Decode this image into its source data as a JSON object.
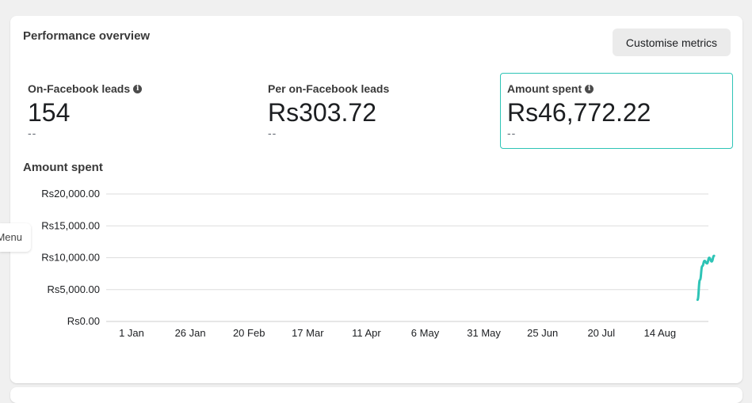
{
  "card": {
    "title": "Performance overview",
    "customise_label": "Customise metrics"
  },
  "metrics": [
    {
      "label": "On-Facebook leads",
      "has_info": true,
      "value": "154",
      "comparison": "--",
      "selected": false
    },
    {
      "label": "Per on-Facebook leads",
      "has_info": false,
      "value": "Rs303.72",
      "comparison": "--",
      "selected": false
    },
    {
      "label": "Amount spent",
      "has_info": true,
      "value": "Rs46,772.22",
      "comparison": "--",
      "selected": true
    }
  ],
  "side_menu": {
    "label": "Menu"
  },
  "icons": {
    "info": "info-icon"
  },
  "colors": {
    "accent": "#2ec4b6",
    "grid": "#dddddd"
  },
  "chart_data": {
    "type": "line",
    "title": "Amount spent",
    "x_ticks": [
      "1 Jan",
      "26 Jan",
      "20 Feb",
      "17 Mar",
      "11 Apr",
      "6 May",
      "31 May",
      "25 Jun",
      "20 Jul",
      "14 Aug"
    ],
    "y_ticks": [
      "Rs0.00",
      "Rs5,000.00",
      "Rs10,000.00",
      "Rs15,000.00",
      "Rs20,000.00"
    ],
    "ylim": [
      0,
      20000
    ],
    "xlim_days": [
      0,
      245
    ],
    "grid": true,
    "series": [
      {
        "color": "#2ec4b6",
        "points": [
          {
            "day": 241,
            "value": 3400
          },
          {
            "day": 242,
            "value": 6500
          },
          {
            "day": 243,
            "value": 8700
          },
          {
            "day": 244,
            "value": 9500
          },
          {
            "day": 245,
            "value": 9100
          },
          {
            "day": 246,
            "value": 10000
          },
          {
            "day": 247,
            "value": 9400
          },
          {
            "day": 248,
            "value": 10300
          }
        ]
      }
    ]
  }
}
